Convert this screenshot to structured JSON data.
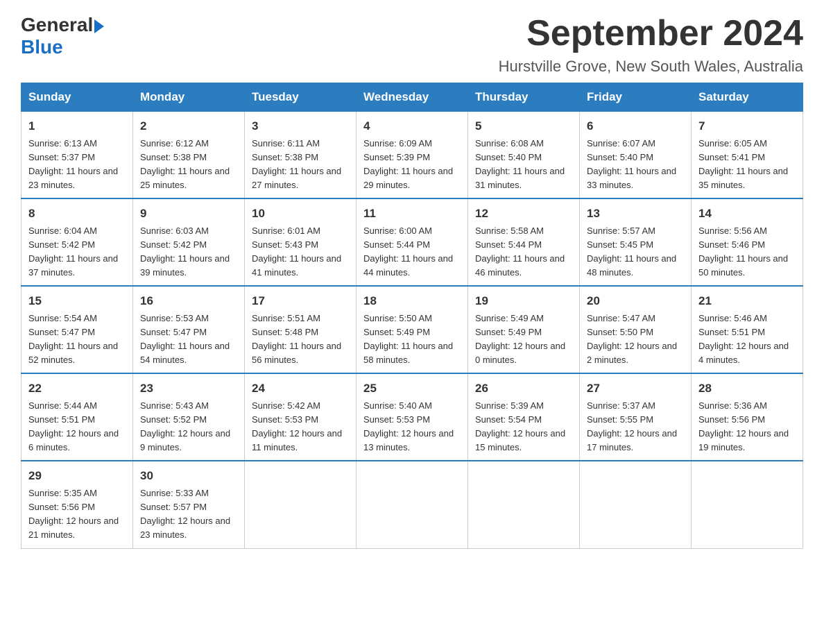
{
  "header": {
    "logo_general": "General",
    "logo_blue": "Blue",
    "month_title": "September 2024",
    "location": "Hurstville Grove, New South Wales, Australia"
  },
  "days_of_week": [
    "Sunday",
    "Monday",
    "Tuesday",
    "Wednesday",
    "Thursday",
    "Friday",
    "Saturday"
  ],
  "weeks": [
    [
      {
        "day": "1",
        "sunrise": "6:13 AM",
        "sunset": "5:37 PM",
        "daylight": "11 hours and 23 minutes."
      },
      {
        "day": "2",
        "sunrise": "6:12 AM",
        "sunset": "5:38 PM",
        "daylight": "11 hours and 25 minutes."
      },
      {
        "day": "3",
        "sunrise": "6:11 AM",
        "sunset": "5:38 PM",
        "daylight": "11 hours and 27 minutes."
      },
      {
        "day": "4",
        "sunrise": "6:09 AM",
        "sunset": "5:39 PM",
        "daylight": "11 hours and 29 minutes."
      },
      {
        "day": "5",
        "sunrise": "6:08 AM",
        "sunset": "5:40 PM",
        "daylight": "11 hours and 31 minutes."
      },
      {
        "day": "6",
        "sunrise": "6:07 AM",
        "sunset": "5:40 PM",
        "daylight": "11 hours and 33 minutes."
      },
      {
        "day": "7",
        "sunrise": "6:05 AM",
        "sunset": "5:41 PM",
        "daylight": "11 hours and 35 minutes."
      }
    ],
    [
      {
        "day": "8",
        "sunrise": "6:04 AM",
        "sunset": "5:42 PM",
        "daylight": "11 hours and 37 minutes."
      },
      {
        "day": "9",
        "sunrise": "6:03 AM",
        "sunset": "5:42 PM",
        "daylight": "11 hours and 39 minutes."
      },
      {
        "day": "10",
        "sunrise": "6:01 AM",
        "sunset": "5:43 PM",
        "daylight": "11 hours and 41 minutes."
      },
      {
        "day": "11",
        "sunrise": "6:00 AM",
        "sunset": "5:44 PM",
        "daylight": "11 hours and 44 minutes."
      },
      {
        "day": "12",
        "sunrise": "5:58 AM",
        "sunset": "5:44 PM",
        "daylight": "11 hours and 46 minutes."
      },
      {
        "day": "13",
        "sunrise": "5:57 AM",
        "sunset": "5:45 PM",
        "daylight": "11 hours and 48 minutes."
      },
      {
        "day": "14",
        "sunrise": "5:56 AM",
        "sunset": "5:46 PM",
        "daylight": "11 hours and 50 minutes."
      }
    ],
    [
      {
        "day": "15",
        "sunrise": "5:54 AM",
        "sunset": "5:47 PM",
        "daylight": "11 hours and 52 minutes."
      },
      {
        "day": "16",
        "sunrise": "5:53 AM",
        "sunset": "5:47 PM",
        "daylight": "11 hours and 54 minutes."
      },
      {
        "day": "17",
        "sunrise": "5:51 AM",
        "sunset": "5:48 PM",
        "daylight": "11 hours and 56 minutes."
      },
      {
        "day": "18",
        "sunrise": "5:50 AM",
        "sunset": "5:49 PM",
        "daylight": "11 hours and 58 minutes."
      },
      {
        "day": "19",
        "sunrise": "5:49 AM",
        "sunset": "5:49 PM",
        "daylight": "12 hours and 0 minutes."
      },
      {
        "day": "20",
        "sunrise": "5:47 AM",
        "sunset": "5:50 PM",
        "daylight": "12 hours and 2 minutes."
      },
      {
        "day": "21",
        "sunrise": "5:46 AM",
        "sunset": "5:51 PM",
        "daylight": "12 hours and 4 minutes."
      }
    ],
    [
      {
        "day": "22",
        "sunrise": "5:44 AM",
        "sunset": "5:51 PM",
        "daylight": "12 hours and 6 minutes."
      },
      {
        "day": "23",
        "sunrise": "5:43 AM",
        "sunset": "5:52 PM",
        "daylight": "12 hours and 9 minutes."
      },
      {
        "day": "24",
        "sunrise": "5:42 AM",
        "sunset": "5:53 PM",
        "daylight": "12 hours and 11 minutes."
      },
      {
        "day": "25",
        "sunrise": "5:40 AM",
        "sunset": "5:53 PM",
        "daylight": "12 hours and 13 minutes."
      },
      {
        "day": "26",
        "sunrise": "5:39 AM",
        "sunset": "5:54 PM",
        "daylight": "12 hours and 15 minutes."
      },
      {
        "day": "27",
        "sunrise": "5:37 AM",
        "sunset": "5:55 PM",
        "daylight": "12 hours and 17 minutes."
      },
      {
        "day": "28",
        "sunrise": "5:36 AM",
        "sunset": "5:56 PM",
        "daylight": "12 hours and 19 minutes."
      }
    ],
    [
      {
        "day": "29",
        "sunrise": "5:35 AM",
        "sunset": "5:56 PM",
        "daylight": "12 hours and 21 minutes."
      },
      {
        "day": "30",
        "sunrise": "5:33 AM",
        "sunset": "5:57 PM",
        "daylight": "12 hours and 23 minutes."
      },
      null,
      null,
      null,
      null,
      null
    ]
  ],
  "labels": {
    "sunrise_prefix": "Sunrise: ",
    "sunset_prefix": "Sunset: ",
    "daylight_prefix": "Daylight: "
  }
}
